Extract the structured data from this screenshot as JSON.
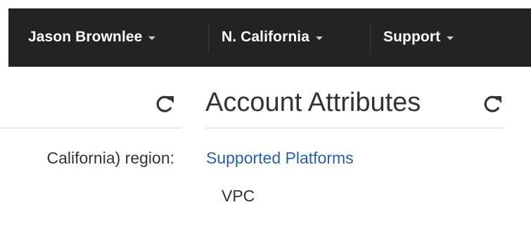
{
  "navbar": {
    "user_label": "Jason Brownlee",
    "region_label": "N. California",
    "support_label": "Support"
  },
  "left_panel": {
    "text": "California) region:"
  },
  "account_attributes": {
    "title": "Account Attributes",
    "supported_platforms_label": "Supported Platforms",
    "platform_value": "VPC"
  },
  "colors": {
    "navbar_bg": "#232323",
    "link": "#2b5ea9",
    "text": "#333333"
  },
  "icons": {
    "refresh": "refresh-icon",
    "caret": "caret-down-icon"
  }
}
